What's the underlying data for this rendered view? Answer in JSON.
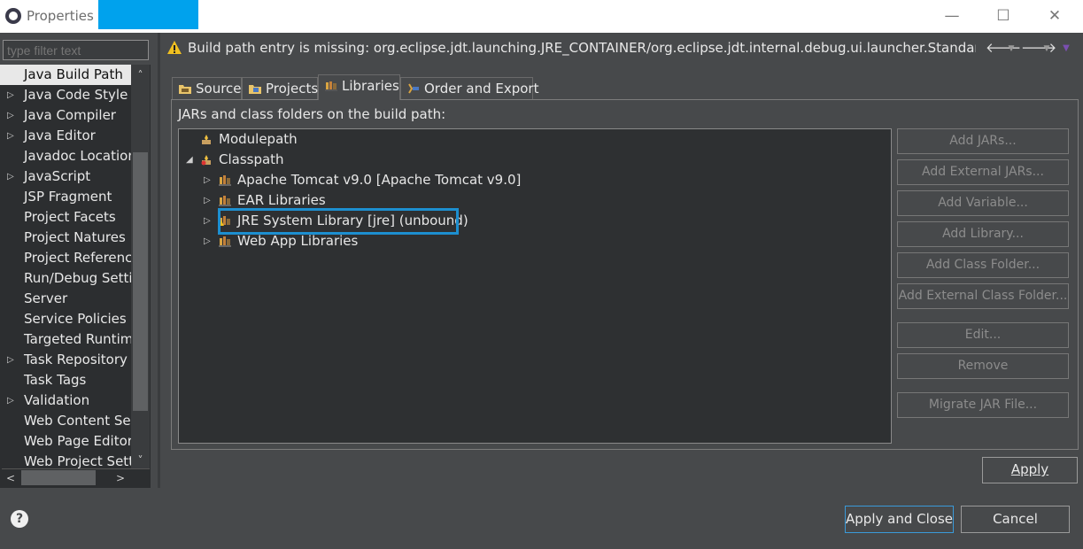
{
  "window": {
    "title": "Properties fo",
    "redaction_color": "#00a2ed",
    "controls": [
      "—",
      "☐",
      "✕"
    ]
  },
  "filter": {
    "placeholder": "type filter text"
  },
  "nav": {
    "items": [
      {
        "label": "Java Build Path",
        "expandable": false,
        "selected": true
      },
      {
        "label": "Java Code Style",
        "expandable": true
      },
      {
        "label": "Java Compiler",
        "expandable": true
      },
      {
        "label": "Java Editor",
        "expandable": true
      },
      {
        "label": "Javadoc Location",
        "expandable": false
      },
      {
        "label": "JavaScript",
        "expandable": true
      },
      {
        "label": "JSP Fragment",
        "expandable": false
      },
      {
        "label": "Project Facets",
        "expandable": false
      },
      {
        "label": "Project Natures",
        "expandable": false
      },
      {
        "label": "Project References",
        "expandable": false
      },
      {
        "label": "Run/Debug Settings",
        "expandable": false
      },
      {
        "label": "Server",
        "expandable": false
      },
      {
        "label": "Service Policies",
        "expandable": false
      },
      {
        "label": "Targeted Runtimes",
        "expandable": false
      },
      {
        "label": "Task Repository",
        "expandable": true
      },
      {
        "label": "Task Tags",
        "expandable": false
      },
      {
        "label": "Validation",
        "expandable": true
      },
      {
        "label": "Web Content Settings",
        "expandable": false
      },
      {
        "label": "Web Page Editor",
        "expandable": false
      },
      {
        "label": "Web Project Settings",
        "expandable": false
      }
    ]
  },
  "message": {
    "text": "Build path entry is missing: org.eclipse.jdt.launching.JRE_CONTAINER/org.eclipse.jdt.internal.debug.ui.launcher.StandardVMType/jre",
    "icon": "warning-icon",
    "warning_color": "#f0c020"
  },
  "tabs": [
    {
      "label": "Source",
      "icon": "source-folder-icon"
    },
    {
      "label": "Projects",
      "icon": "projects-icon"
    },
    {
      "label": "Libraries",
      "icon": "libraries-icon",
      "active": true
    },
    {
      "label": "Order and Export",
      "icon": "order-export-icon"
    }
  ],
  "libraries": {
    "description": "JARs and class folders on the build path:",
    "tree": [
      {
        "label": "Modulepath",
        "icon": "modulepath-icon"
      },
      {
        "label": "Classpath",
        "icon": "classpath-icon",
        "expanded": true
      },
      {
        "label": "Apache Tomcat v9.0 [Apache Tomcat v9.0]",
        "icon": "library-icon"
      },
      {
        "label": "EAR Libraries",
        "icon": "library-icon"
      },
      {
        "label": "JRE System Library [jre] (unbound)",
        "icon": "library-warning-icon",
        "highlighted": true
      },
      {
        "label": "Web App Libraries",
        "icon": "library-icon"
      }
    ],
    "highlight_color": "#1d8fd0",
    "buttons": [
      {
        "label": "Add JARs...",
        "enabled": false
      },
      {
        "label": "Add External JARs...",
        "enabled": false
      },
      {
        "label": "Add Variable...",
        "enabled": false
      },
      {
        "label": "Add Library...",
        "enabled": false
      },
      {
        "label": "Add Class Folder...",
        "enabled": false
      },
      {
        "label": "Add External Class Folder...",
        "enabled": false
      },
      {
        "label": "Edit...",
        "enabled": false
      },
      {
        "label": "Remove",
        "enabled": false
      },
      {
        "label": "Migrate JAR File...",
        "enabled": false
      }
    ]
  },
  "footer": {
    "apply": "Apply",
    "apply_and_close": "Apply and Close",
    "cancel": "Cancel",
    "help": "?"
  }
}
